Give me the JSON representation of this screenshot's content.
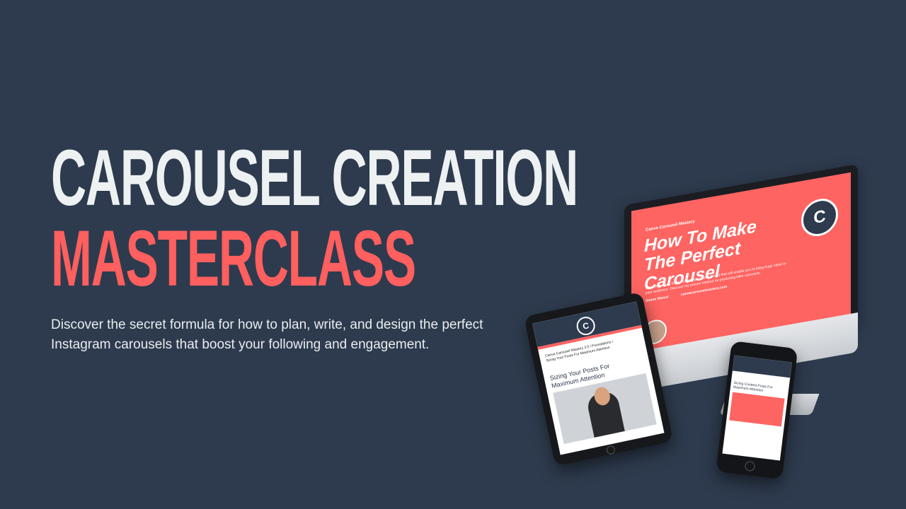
{
  "hero": {
    "title_line1": "CAROUSEL CREATION",
    "title_line2": "MASTERCLASS",
    "subtitle": "Discover the secret formula for how to plan, write, and design the perfect Instagram carousels that boost your following and engagement."
  },
  "imac_screen": {
    "small_label": "Canva Carousel Mastery",
    "title": "How To Make The Perfect Carousel",
    "body": "Carousels are a highly engaging content format that will enable you to bring huge value to your audience. Discover my proven method for producing killer carousels.",
    "author": "Simon Marcel",
    "url": "canvacarouselmastery.com",
    "logo_letter": "C"
  },
  "ipad_screen": {
    "logo_letter": "C",
    "course_path": "Canva Carousel Mastery 3.0 / Foundations / Sizing Your Posts For Maximum Attention",
    "lesson_title": "Sizing Your Posts For Maximum Attention"
  },
  "iphone_screen": {
    "lesson_title": "Sizing Content Posts For Maximum Attention"
  },
  "colors": {
    "background": "#2e3b4e",
    "accent": "#fe5f5f",
    "title_white": "#eef1f2"
  }
}
